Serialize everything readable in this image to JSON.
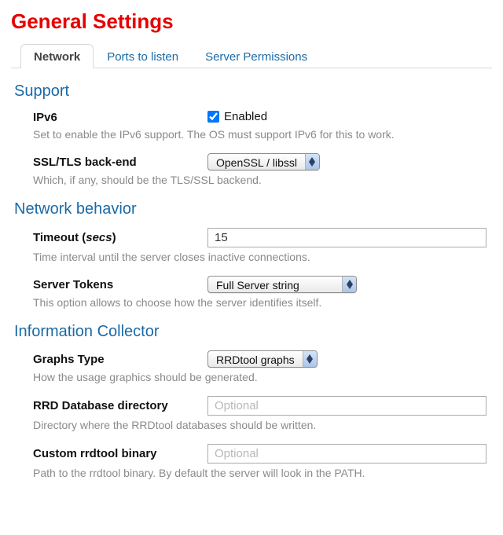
{
  "page_title": "General Settings",
  "tabs": {
    "network": "Network",
    "ports": "Ports to listen",
    "perms": "Server Permissions"
  },
  "sections": {
    "support": {
      "title": "Support",
      "ipv6": {
        "label": "IPv6",
        "checkbox_label": "Enabled",
        "checked": true,
        "help": "Set to enable the IPv6 support. The OS must support IPv6 for this to work."
      },
      "ssl": {
        "label": "SSL/TLS back-end",
        "value": "OpenSSL / libssl",
        "help": "Which, if any, should be the TLS/SSL backend."
      }
    },
    "behavior": {
      "title": "Network behavior",
      "timeout": {
        "label_pre": "Timeout (",
        "label_em": "secs",
        "label_post": ")",
        "value": "15",
        "help": "Time interval until the server closes inactive connections."
      },
      "tokens": {
        "label": "Server Tokens",
        "value": "Full Server string",
        "help": "This option allows to choose how the server identifies itself."
      }
    },
    "collector": {
      "title": "Information Collector",
      "graphs": {
        "label": "Graphs Type",
        "value": "RRDtool graphs",
        "help": "How the usage graphics should be generated."
      },
      "rrd_dir": {
        "label": "RRD Database directory",
        "placeholder": "Optional",
        "help": "Directory where the RRDtool databases should be written."
      },
      "rrd_bin": {
        "label": "Custom rrdtool binary",
        "placeholder": "Optional",
        "help": "Path to the rrdtool binary. By default the server will look in the PATH."
      }
    }
  }
}
